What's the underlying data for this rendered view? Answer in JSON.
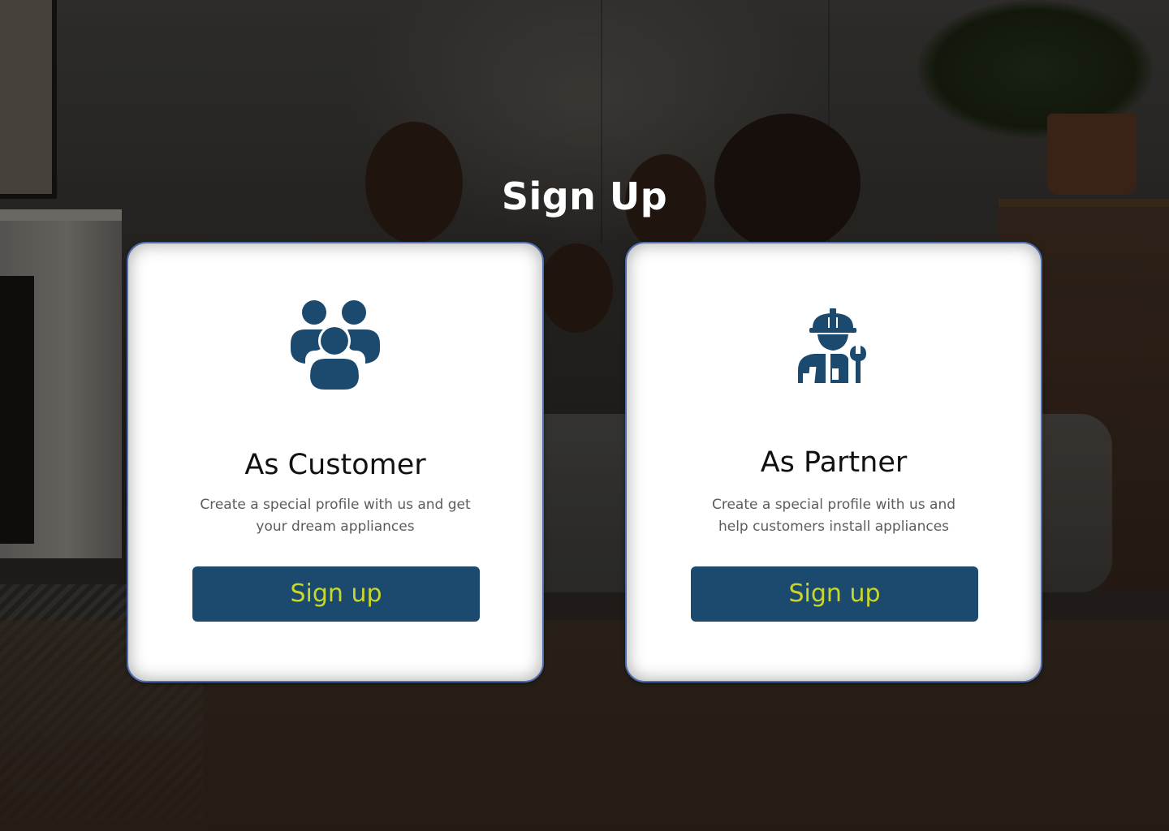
{
  "page": {
    "title": "Sign Up"
  },
  "cards": {
    "customer": {
      "icon": "users-group-icon",
      "heading": "As Customer",
      "description": "Create a special profile with us and get your dream appliances",
      "button_label": "Sign up"
    },
    "partner": {
      "icon": "technician-wrench-icon",
      "heading": "As Partner",
      "description": "Create a special profile with us and help customers install appliances",
      "button_label": "Sign up"
    }
  },
  "colors": {
    "primary": "#1c4a6e",
    "button_text": "#c8d82a",
    "card_border": "#4f6fae",
    "card_background": "#ffffff",
    "title_text": "#ffffff"
  }
}
